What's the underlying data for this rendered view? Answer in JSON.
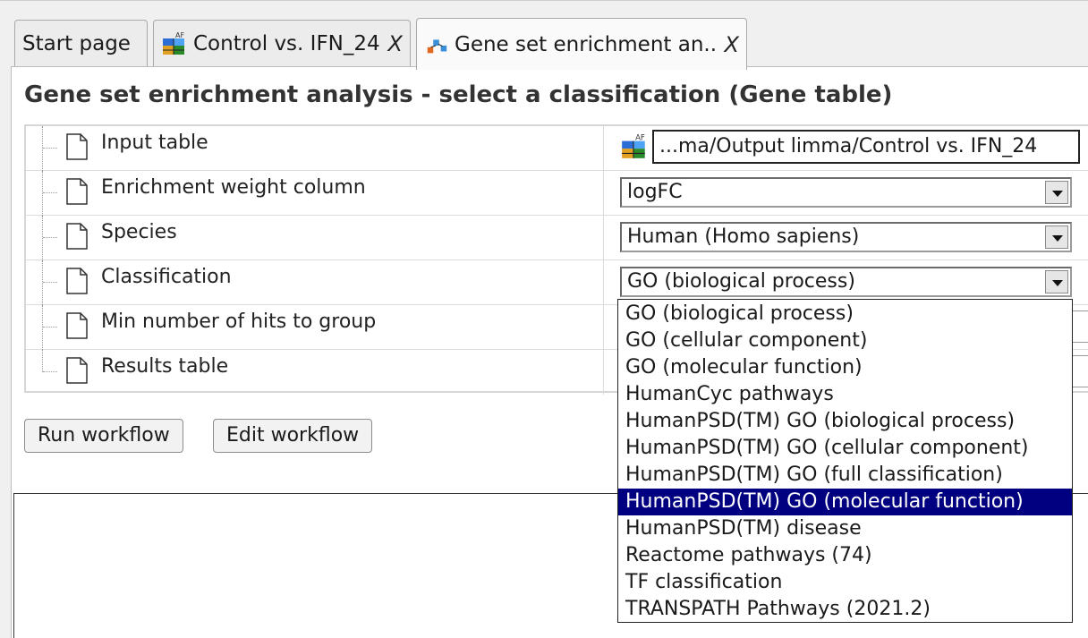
{
  "tabs": [
    {
      "label": "Start page",
      "closable": false,
      "active": false
    },
    {
      "label": "Control vs. IFN_24",
      "closable": true,
      "close_label": "X",
      "icon": "table-icon",
      "active": false
    },
    {
      "label": "Gene set enrichment an...",
      "closable": true,
      "close_label": "X",
      "icon": "workflow-icon",
      "active": true
    }
  ],
  "page": {
    "title": "Gene set enrichment analysis - select a classification (Gene table)"
  },
  "form": {
    "rows": [
      {
        "label": "Input table",
        "value": "...ma/Output limma/Control vs. IFN_24",
        "kind": "path-field"
      },
      {
        "label": "Enrichment weight column",
        "value": "logFC",
        "kind": "select"
      },
      {
        "label": "Species",
        "value": "Human (Homo sapiens)",
        "kind": "select"
      },
      {
        "label": "Classification",
        "value": "GO (biological process)",
        "kind": "select"
      },
      {
        "label": "Min number of hits to group",
        "value": "",
        "kind": "field"
      },
      {
        "label": "Results table",
        "value": "",
        "kind": "field"
      }
    ]
  },
  "buttons": {
    "run": "Run workflow",
    "edit": "Edit workflow"
  },
  "dropdown": {
    "options": [
      "GO (biological process)",
      "GO (cellular component)",
      "GO (molecular function)",
      "HumanCyc pathways",
      "HumanPSD(TM) GO (biological process)",
      "HumanPSD(TM) GO (cellular component)",
      "HumanPSD(TM) GO (full classification)",
      "HumanPSD(TM) GO (molecular function)",
      "HumanPSD(TM) disease",
      "Reactome pathways (74)",
      "TF classification",
      "TRANSPATH Pathways (2021.2)"
    ],
    "highlighted": "HumanPSD(TM) GO (molecular function)",
    "highlight_color": "#000080"
  }
}
